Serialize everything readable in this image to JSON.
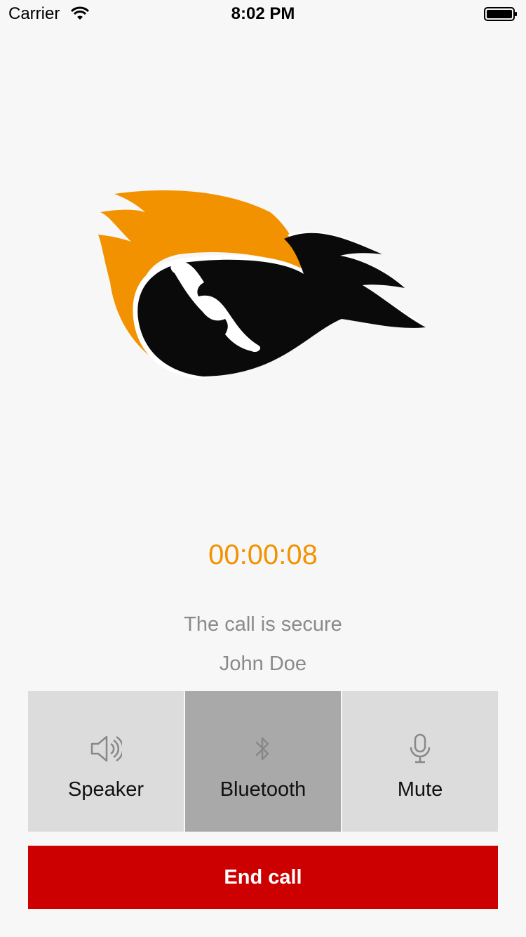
{
  "status_bar": {
    "carrier": "Carrier",
    "time": "8:02 PM"
  },
  "call": {
    "timer": "00:00:08",
    "security_status": "The call is secure",
    "contact_name": "John Doe"
  },
  "controls": [
    {
      "label": "Speaker",
      "icon": "speaker-icon",
      "active": false
    },
    {
      "label": "Bluetooth",
      "icon": "bluetooth-icon",
      "active": true
    },
    {
      "label": "Mute",
      "icon": "microphone-icon",
      "active": false
    }
  ],
  "end_call": {
    "label": "End call"
  },
  "colors": {
    "accent": "#f39200",
    "end_call": "#cc0000",
    "control_bg": "#dcdcdc",
    "control_active_bg": "#a9a9a9",
    "secondary_text": "#8a8a8a"
  }
}
